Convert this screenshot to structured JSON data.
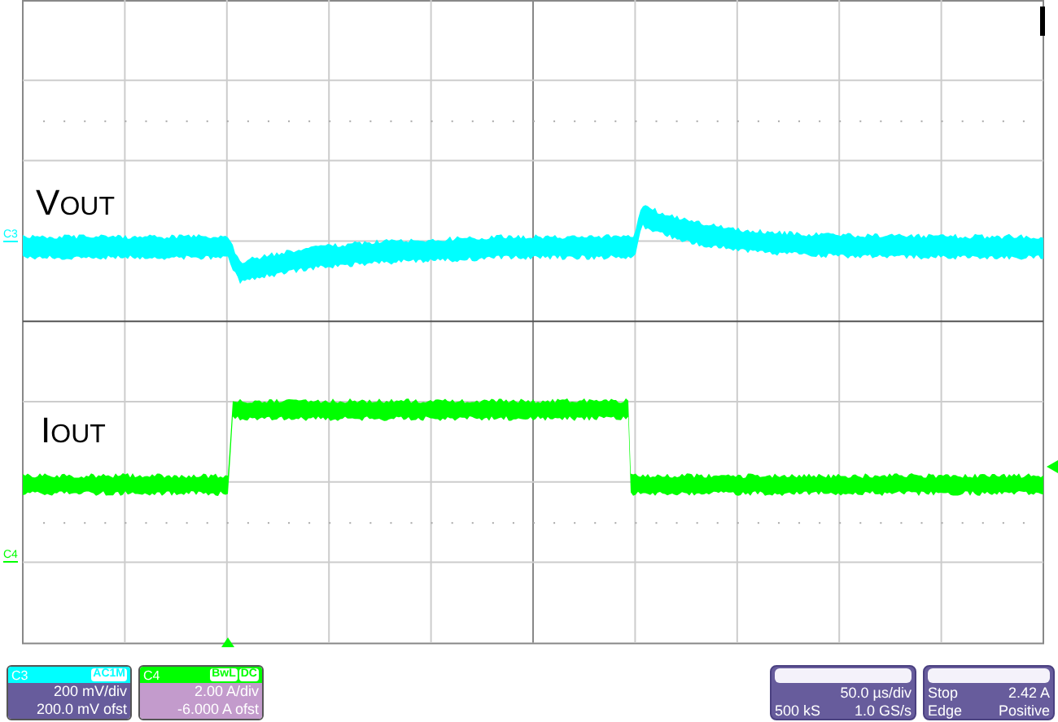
{
  "traces": [
    {
      "label": "V$_{OUT}$",
      "channel": "C3",
      "color": "#00ffff",
      "kind": "voltage"
    },
    {
      "label": "I$_{OUT}$",
      "channel": "C4",
      "color": "#00ff00",
      "kind": "current"
    }
  ],
  "channels": [
    {
      "name": "C3",
      "color": "#00ffff",
      "selected": false,
      "badges": [
        "AC1M"
      ],
      "scale": "200 mV/div",
      "offset": "200.0 mV ofst"
    },
    {
      "name": "C4",
      "color": "#00ff00",
      "selected": true,
      "badges": [
        "BwL",
        "DC"
      ],
      "scale": "2.00 A/div",
      "offset": "-6.000 A ofst"
    }
  ],
  "timebase": {
    "time_per_div": "50.0 µs/div",
    "samples": "500 kS",
    "rate": "1.0 GS/s"
  },
  "trigger": {
    "mode": "Stop",
    "level": "2.42 A",
    "type": "Edge",
    "slope": "Positive"
  }
}
